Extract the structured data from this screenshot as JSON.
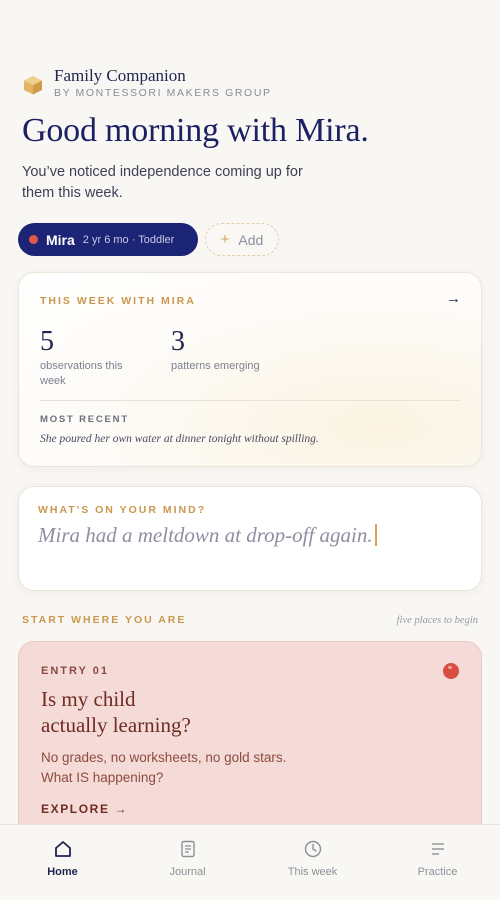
{
  "header": {
    "brand_name": "Family Companion",
    "brand_sub": "BY MONTESSORI MAKERS GROUP",
    "greeting": "Good morning with Mira.",
    "subline": "You’ve noticed independence coming up for them this week."
  },
  "children": {
    "active": {
      "name": "Mira",
      "meta": "2 yr 6 mo · Toddler",
      "dot_color": "#e0584a"
    },
    "add_label": "Add"
  },
  "week_card": {
    "eyebrow": "THIS WEEK WITH MIRA",
    "stats": [
      {
        "value": "5",
        "label": "observations this week"
      },
      {
        "value": "3",
        "label": "patterns emerging"
      }
    ],
    "recent_label": "MOST RECENT",
    "recent_text": "She poured her own water at dinner tonight without spilling."
  },
  "mind_card": {
    "eyebrow": "WHAT'S ON YOUR MIND?",
    "input_value": "Mira had a meltdown at drop-off again."
  },
  "section": {
    "title": "START WHERE YOU ARE",
    "aside": "five places to begin"
  },
  "entry": {
    "eyebrow": "ENTRY 01",
    "title_line1": "Is my child",
    "title_line2": "actually learning?",
    "desc_line1": "No grades, no worksheets, no gold stars.",
    "desc_line2": "What IS happening?",
    "cta": "EXPLORE →",
    "accent_color": "#d94e42"
  },
  "nav": {
    "items": [
      {
        "label": "Home",
        "icon": "home-icon",
        "active": true
      },
      {
        "label": "Journal",
        "icon": "journal-icon",
        "active": false
      },
      {
        "label": "This week",
        "icon": "clock-icon",
        "active": false
      },
      {
        "label": "Practice",
        "icon": "menu-icon",
        "active": false
      }
    ]
  },
  "colors": {
    "background": "#f9f7f3",
    "primary": "#1c2475",
    "accent_gold": "#c9984e",
    "entry_bg": "#f4dbd7"
  }
}
